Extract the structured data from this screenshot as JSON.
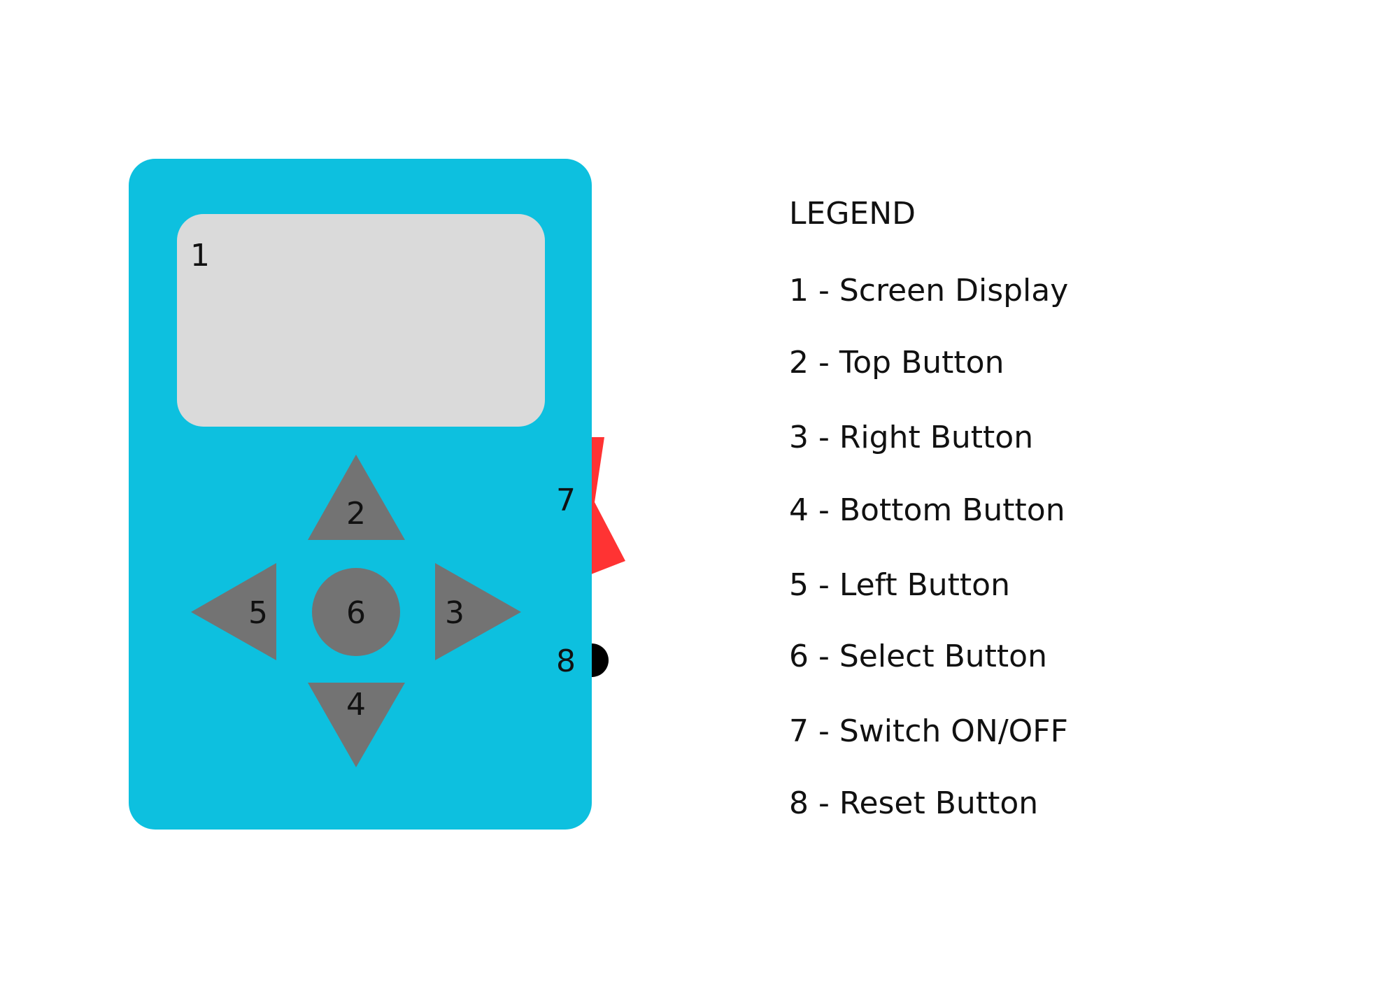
{
  "colors": {
    "body": "#0DC0DF",
    "screen": "#DADADA",
    "buttons": "#737373",
    "switch": "#FF3333",
    "reset": "#000000"
  },
  "device": {
    "labels": {
      "screen": "1",
      "top": "2",
      "right": "3",
      "bottom": "4",
      "left": "5",
      "select": "6",
      "switch": "7",
      "reset": "8"
    }
  },
  "legend": {
    "title": "LEGEND",
    "items": [
      "1 - Screen Display",
      "2 - Top Button",
      "3 - Right Button",
      "4 - Bottom Button",
      "5 - Left Button",
      "6 - Select Button",
      "7 - Switch ON/OFF",
      "8 - Reset Button"
    ]
  }
}
